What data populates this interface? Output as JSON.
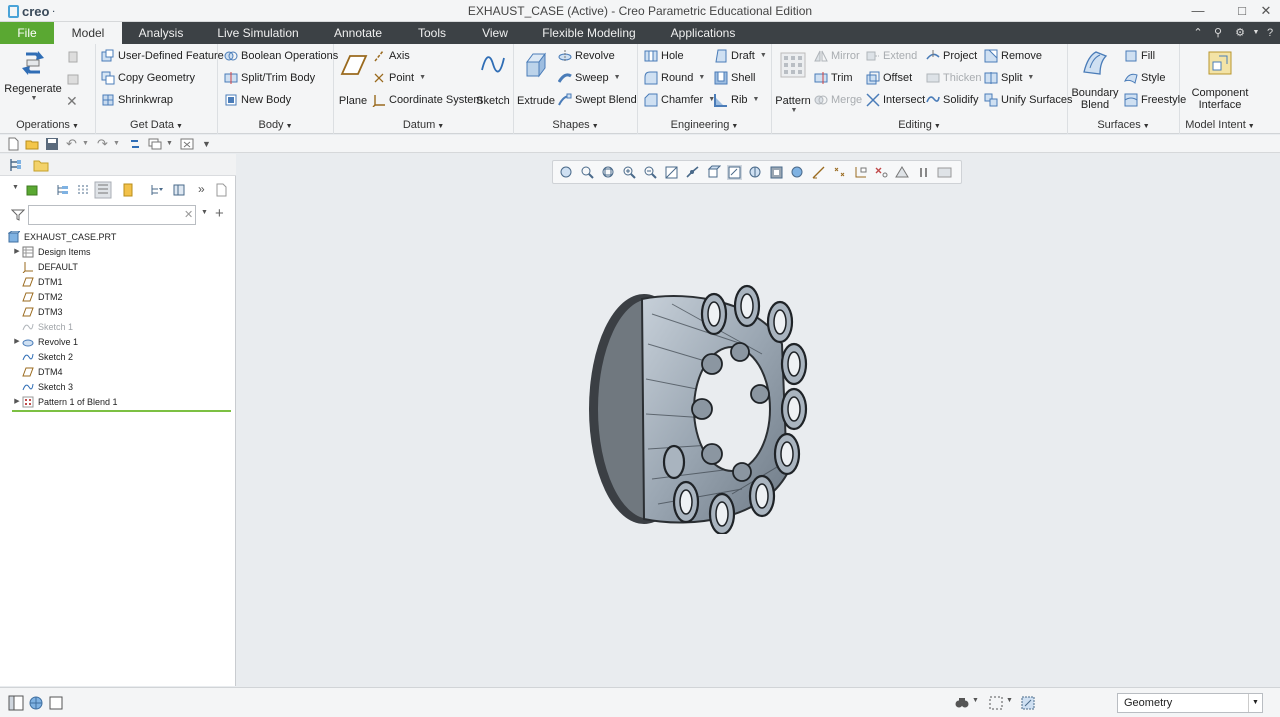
{
  "app": {
    "logo": "creo",
    "logo_mark": "·"
  },
  "window": {
    "title": "EXHAUST_CASE (Active) - Creo Parametric Educational Edition",
    "controls": [
      "minimize-icon",
      "maximize-icon",
      "close-icon"
    ]
  },
  "tabs": [
    {
      "label": "File"
    },
    {
      "label": "Model"
    },
    {
      "label": "Analysis"
    },
    {
      "label": "Live Simulation"
    },
    {
      "label": "Annotate"
    },
    {
      "label": "Tools"
    },
    {
      "label": "View"
    },
    {
      "label": "Flexible Modeling"
    },
    {
      "label": "Applications"
    }
  ],
  "ribbon": {
    "operations": {
      "label": "Operations",
      "regenerate": "Regenerate"
    },
    "get_data": {
      "label": "Get Data",
      "items": [
        "User-Defined Feature",
        "Copy Geometry",
        "Shrinkwrap"
      ]
    },
    "body": {
      "label": "Body",
      "items": [
        "Boolean Operations",
        "Split/Trim Body",
        "New Body"
      ]
    },
    "datum": {
      "label": "Datum",
      "plane": "Plane",
      "axis": "Axis",
      "point": "Point",
      "csys": "Coordinate System",
      "sketch": "Sketch"
    },
    "shapes": {
      "label": "Shapes",
      "extrude": "Extrude",
      "revolve": "Revolve",
      "sweep": "Sweep",
      "swept_blend": "Swept Blend"
    },
    "engineering": {
      "label": "Engineering",
      "hole": "Hole",
      "round": "Round",
      "chamfer": "Chamfer",
      "draft": "Draft",
      "shell": "Shell",
      "rib": "Rib"
    },
    "editing": {
      "label": "Editing",
      "pattern": "Pattern",
      "mirror": "Mirror",
      "trim": "Trim",
      "merge": "Merge",
      "extend": "Extend",
      "offset": "Offset",
      "intersect": "Intersect",
      "project": "Project",
      "thicken": "Thicken",
      "solidify": "Solidify",
      "remove": "Remove",
      "split": "Split",
      "unify": "Unify Surfaces"
    },
    "surfaces": {
      "label": "Surfaces",
      "boundary_blend_1": "Boundary",
      "boundary_blend_2": "Blend",
      "fill": "Fill",
      "style": "Style",
      "freestyle": "Freestyle"
    },
    "model_intent": {
      "label": "Model Intent",
      "component_1": "Component",
      "component_2": "Interface"
    }
  },
  "model_tree": {
    "filter_placeholder": "",
    "items": [
      {
        "label": "EXHAUST_CASE.PRT",
        "icon": "part-icon",
        "expandable": false,
        "dim": false
      },
      {
        "label": "Design Items",
        "icon": "design-items-icon",
        "expandable": true,
        "dim": false
      },
      {
        "label": "DEFAULT",
        "icon": "csys-icon",
        "expandable": false,
        "dim": false
      },
      {
        "label": "DTM1",
        "icon": "datum-plane-icon",
        "expandable": false,
        "dim": false
      },
      {
        "label": "DTM2",
        "icon": "datum-plane-icon",
        "expandable": false,
        "dim": false
      },
      {
        "label": "DTM3",
        "icon": "datum-plane-icon",
        "expandable": false,
        "dim": false
      },
      {
        "label": "Sketch 1",
        "icon": "sketch-icon",
        "expandable": false,
        "dim": true
      },
      {
        "label": "Revolve 1",
        "icon": "revolve-icon",
        "expandable": true,
        "dim": false
      },
      {
        "label": "Sketch 2",
        "icon": "sketch-icon",
        "expandable": false,
        "dim": false
      },
      {
        "label": "DTM4",
        "icon": "datum-plane-icon",
        "expandable": false,
        "dim": false
      },
      {
        "label": "Sketch 3",
        "icon": "sketch-icon",
        "expandable": false,
        "dim": false
      },
      {
        "label": "Pattern 1 of Blend 1",
        "icon": "pattern-icon",
        "expandable": true,
        "dim": false
      }
    ]
  },
  "status": {
    "selection_filter": "Geometry"
  },
  "colors": {
    "accent_green": "#5aa832",
    "tab_bar": "#3c4145",
    "model_gray": "#9aa6b2"
  }
}
